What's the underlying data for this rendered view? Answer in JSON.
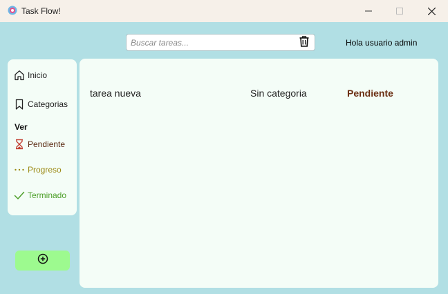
{
  "window": {
    "title": "Task Flow!"
  },
  "header": {
    "search_placeholder": "Buscar tareas...",
    "greeting": "Hola usuario admin"
  },
  "sidebar": {
    "items": [
      {
        "label": "Inicio",
        "icon": "home-icon"
      },
      {
        "label": "Categorias",
        "icon": "bookmark-icon"
      }
    ],
    "section_label": "Ver",
    "filters": [
      {
        "label": "Pendiente",
        "icon": "hourglass-icon",
        "color": "#5a2a12"
      },
      {
        "label": "Progreso",
        "icon": "more-dots-icon",
        "color": "#9c8a14"
      },
      {
        "label": "Terminado",
        "icon": "checkmark-icon",
        "color": "#4fa02c"
      }
    ],
    "add_button_icon": "add-circle-icon"
  },
  "tasks": [
    {
      "name": "tarea nueva",
      "category": "Sin categoria",
      "status": "Pendiente"
    }
  ],
  "colors": {
    "background": "#b1dfe4",
    "panel": "#f4fdf7",
    "titlebar": "#f6f0e9",
    "add_button": "#9dfa8f",
    "status_pendiente": "#6b2e12"
  }
}
